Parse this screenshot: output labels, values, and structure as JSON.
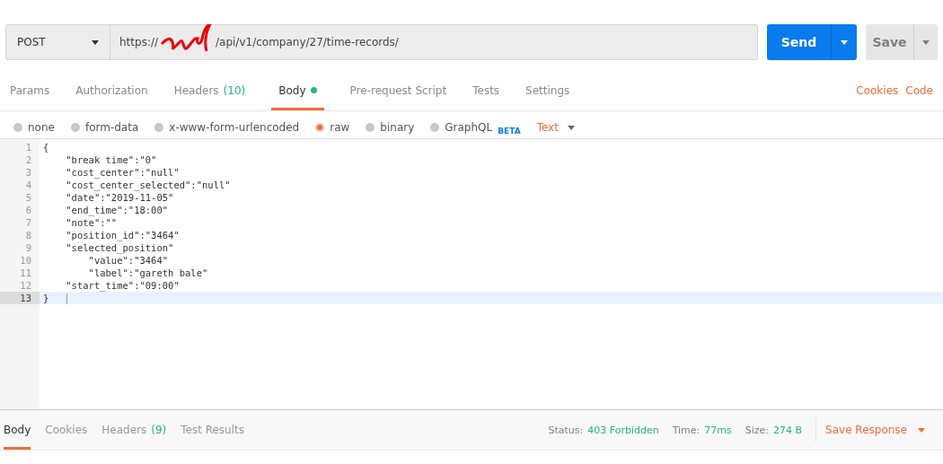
{
  "request": {
    "method": "POST",
    "url_prefix": "https://",
    "url_path": "/api/v1/company/27/time-records/",
    "send": "Send",
    "save": "Save"
  },
  "tabs": [
    {
      "label": "Params",
      "selected": false,
      "dot": false
    },
    {
      "label": "Authorization",
      "selected": false,
      "dot": false
    },
    {
      "label": "Headers",
      "count": "(10)",
      "selected": false,
      "dot": false
    },
    {
      "label": "Body",
      "selected": true,
      "dot": true
    },
    {
      "label": "Pre-request Script",
      "selected": false,
      "dot": false
    },
    {
      "label": "Tests",
      "selected": false,
      "dot": false
    },
    {
      "label": "Settings",
      "selected": false,
      "dot": false
    }
  ],
  "links": [
    "Cookies",
    "Code"
  ],
  "body_types": [
    {
      "label": "none",
      "selected": false
    },
    {
      "label": "form-data",
      "selected": false
    },
    {
      "label": "x-www-form-urlencoded",
      "selected": false
    },
    {
      "label": "raw",
      "selected": true
    },
    {
      "label": "binary",
      "selected": false
    },
    {
      "label": "GraphQL",
      "badge": "BETA",
      "selected": false
    }
  ],
  "format": "Text",
  "editor": {
    "lines": [
      {
        "number": "1",
        "text": "{",
        "active": false
      },
      {
        "number": "2",
        "text": "    \"break time\":\"0\"",
        "active": false
      },
      {
        "number": "3",
        "text": "    \"cost_center\":\"null\"",
        "active": false
      },
      {
        "number": "4",
        "text": "    \"cost_center_selected\":\"null\"",
        "active": false
      },
      {
        "number": "5",
        "text": "    \"date\":\"2019-11-05\"",
        "active": false
      },
      {
        "number": "6",
        "text": "    \"end_time\":\"18:00\"",
        "active": false
      },
      {
        "number": "7",
        "text": "    \"note\":\"\"",
        "active": false
      },
      {
        "number": "8",
        "text": "    \"position_id\":\"3464\"",
        "active": false
      },
      {
        "number": "9",
        "text": "    \"selected_position\"",
        "active": false
      },
      {
        "number": "10",
        "text": "        \"value\":\"3464\"",
        "active": false
      },
      {
        "number": "11",
        "text": "        \"label\":\"gareth bale\"",
        "active": false
      },
      {
        "number": "12",
        "text": "    \"start_time\":\"09:00\"",
        "active": false
      },
      {
        "number": "13",
        "text": "}",
        "active": true
      }
    ]
  },
  "response": {
    "tabs": [
      {
        "label": "Body",
        "selected": true
      },
      {
        "label": "Cookies",
        "selected": false
      },
      {
        "label": "Headers",
        "count": "(9)",
        "selected": false
      },
      {
        "label": "Test Results",
        "selected": false
      }
    ],
    "stats": [
      {
        "label": "Status:",
        "value": "403 Forbidden"
      },
      {
        "label": "Time:",
        "value": "77ms"
      },
      {
        "label": "Size:",
        "value": "274 B"
      }
    ],
    "save_response": "Save Response"
  }
}
